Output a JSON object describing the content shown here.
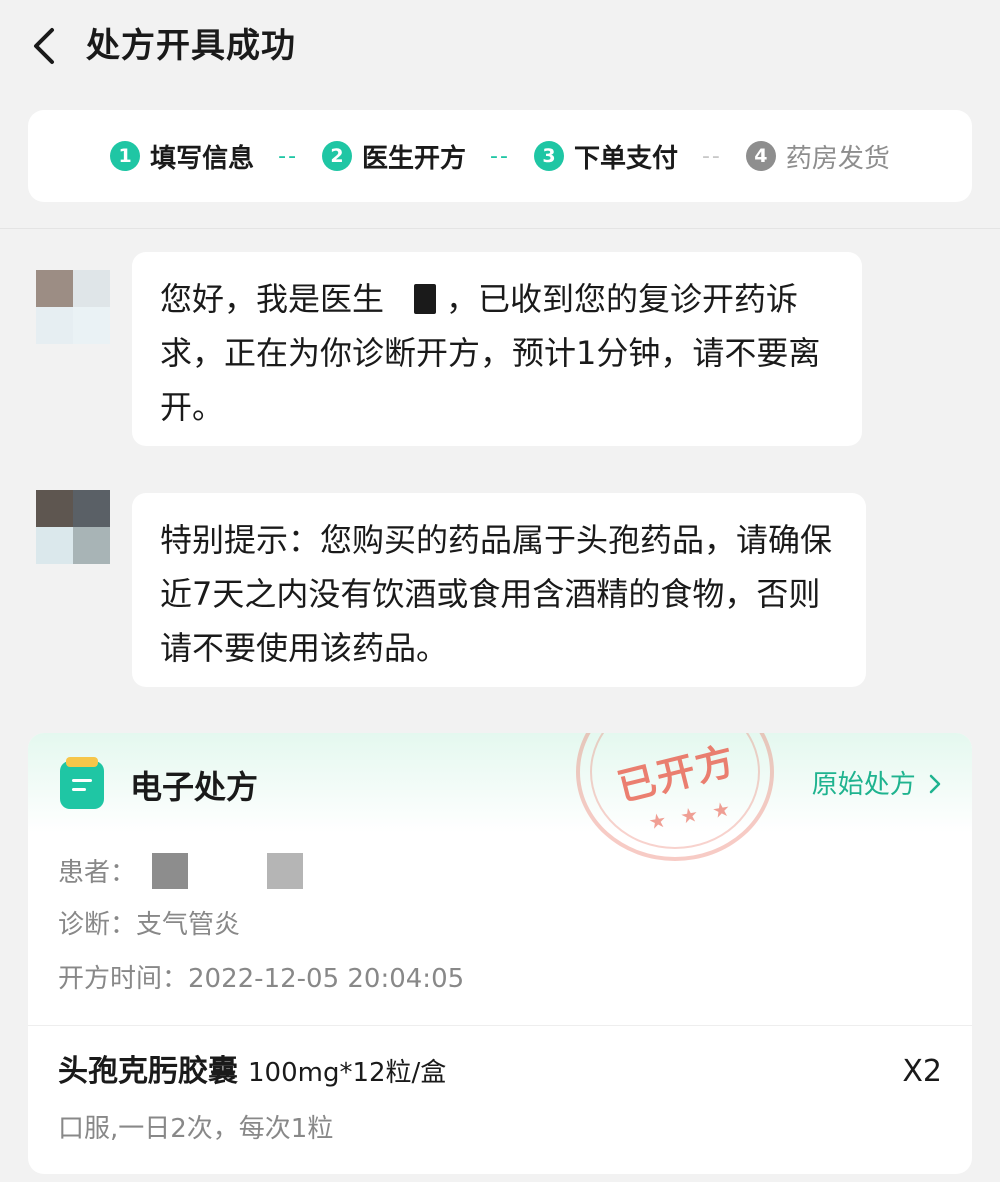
{
  "header": {
    "title": "处方开具成功"
  },
  "steps": [
    {
      "num": "1",
      "label": "填写信息",
      "active": true
    },
    {
      "num": "2",
      "label": "医生开方",
      "active": true
    },
    {
      "num": "3",
      "label": "下单支付",
      "active": true
    },
    {
      "num": "4",
      "label": "药房发货",
      "active": false
    }
  ],
  "step_separator": "--",
  "messages": [
    {
      "text_before": "您好，我是医生",
      "text_after": "，已收到您的复诊开药诉求，正在为你诊断开方，预计1分钟，请不要离开。"
    },
    {
      "text": "特别提示：您购买的药品属于头孢药品，请确保近7天之内没有饮酒或食用含酒精的食物，否则请不要使用该药品。"
    }
  ],
  "prescription": {
    "title": "电子处方",
    "original_link": "原始处方",
    "stamp_text": "已开方",
    "stamp_stars": "★ ★ ★",
    "patient_label": "患者：",
    "diagnosis_label": "诊断：",
    "diagnosis_value": "支气管炎",
    "time_label": "开方时间：",
    "time_value": "2022-12-05 20:04:05",
    "drug": {
      "name": "头孢克肟胶囊",
      "spec": "100mg*12粒/盒",
      "quantity": "X2",
      "usage": "口服,一日2次，每次1粒"
    }
  },
  "colors": {
    "accent": "#1fc6a4",
    "link": "#1fb38f",
    "stamp": "#e85f4e",
    "inactive": "#8e8e8e"
  }
}
